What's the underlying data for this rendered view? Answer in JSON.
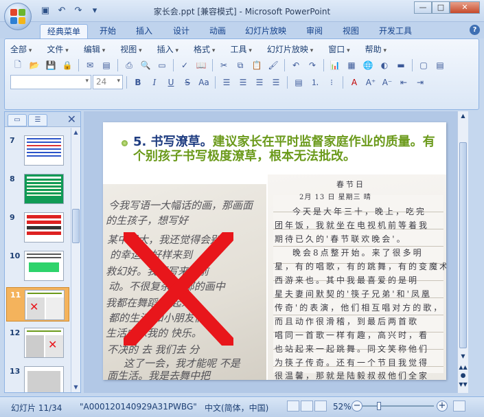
{
  "window": {
    "title": "家长会.ppt [兼容模式] - Microsoft PowerPoint",
    "controls": [
      "—",
      "□",
      "✕"
    ]
  },
  "ribbon_tabs": [
    "经典菜单",
    "开始",
    "插入",
    "设计",
    "动画",
    "幻灯片放映",
    "审阅",
    "视图",
    "开发工具"
  ],
  "classic_menus": [
    "全部",
    "文件",
    "编辑",
    "视图",
    "插入",
    "格式",
    "工具",
    "幻灯片放映",
    "窗口",
    "帮助"
  ],
  "format_bar": {
    "font_size": "24",
    "font_buttons": [
      "B",
      "I",
      "U",
      "S",
      "Aa"
    ]
  },
  "slide_pane": {
    "slides": [
      {
        "number": "7",
        "selected": false
      },
      {
        "number": "8",
        "selected": false
      },
      {
        "number": "9",
        "selected": false
      },
      {
        "number": "10",
        "selected": false
      },
      {
        "number": "11",
        "selected": true
      },
      {
        "number": "12",
        "selected": false
      },
      {
        "number": "13",
        "selected": false
      }
    ]
  },
  "slide": {
    "bullet_lead": "5. 书写潦草。",
    "bullet_rest": "建议家长在平时监督家庭作业的质量。有个别孩子书写极度潦草，根本无法批改。",
    "photo_right_heading": "春节日",
    "photo_right_date": "2月 13 日  星期三    晴",
    "photo_right_lines": [
      "今天是大年三十，晚上，吃完",
      "团年饭，我就坐在电视机前等着我",
      "期待已久的'春节联欢晚会'。",
      "晚会8点整开始。来了很多明",
      "星，有的唱歌，有的跳舞，有的变魔术，",
      "西游来也。其中我最喜爱的是明",
      "星夫妻间默契的'筷子兄弟'和'凤凰",
      "传奇'的表演，他们相互唱对方的歌，",
      "而且动作很滑稽，到最后两首歌",
      "唱同一首歌一样有趣，高兴时，看",
      "也站起来一起跳舞。同文笑称他们",
      "为筷子传奇。还有一个节目我觉得",
      "很温馨，那就是陆毅叔叔他们全家"
    ],
    "photo_left_lines": [
      "今我写语一大幅话的画，那画面",
      "的生孩子，想写好",
      "某中很大，我还觉得会别生",
      "的幸运，好样来到",
      "救幻好。我要写来，前",
      "动。不很复杂 全部的画中",
      "我都在舞蹈的 起来",
      "都的生活 和小朋友们",
      "生活中乐我的 快乐。",
      "不决的 去 我们去 分",
      "这了一会，我才能呢 不是",
      "面生活。我是去舞中把"
    ]
  },
  "status_bar": {
    "slide_info": "幻灯片 11/34",
    "theme": "\"A000120140929A31PWBG\"",
    "language": "中文(简体，中国)",
    "zoom": "52%",
    "zoom_percent": 52
  },
  "colors": {
    "bullet_green": "#6b9a1b",
    "bullet_lead_blue": "#1e3c80",
    "selected_slide": "#f4b35c",
    "red_x": "#e8161b"
  }
}
